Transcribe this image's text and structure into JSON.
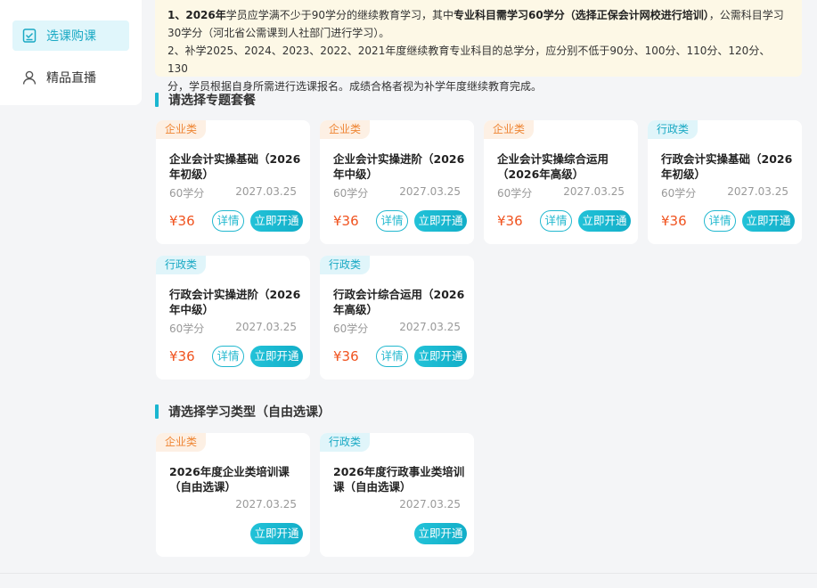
{
  "sidebar": {
    "items": [
      {
        "label": "选课购课",
        "icon": "checkbox-list-icon",
        "active": true
      },
      {
        "label": "精品直播",
        "icon": "user-icon",
        "active": false
      }
    ]
  },
  "notice": {
    "l1_a": "1、2026年",
    "l1_b": "学员应学满不少于90学分的继续教育学习，其中",
    "l1_c": "专业科目需学习60学分（选择正保会计网校进行培训）",
    "l1_d": "，公需科目学习",
    "l2": "30学分（河北省公需课到人社部门进行学习）。",
    "l3": "2、补学2025、2024、2023、2022、2021年度继续教育专业科目的总学分，应分别不低于90分、100分、110分、120分、130",
    "l4": "分，学员根据自身所需进行选课报名。成绩合格者视为补学年度继续教育完成。"
  },
  "section1": {
    "title": "请选择专题套餐",
    "cards": [
      {
        "tag": "企业类",
        "tag_type": "ent",
        "title": "企业会计实操基础（2026年初级）",
        "credits": "60学分",
        "date": "2027.03.25",
        "price": "¥36",
        "detail": "详情",
        "open": "立即开通"
      },
      {
        "tag": "企业类",
        "tag_type": "ent",
        "title": "企业会计实操进阶（2026年中级）",
        "credits": "60学分",
        "date": "2027.03.25",
        "price": "¥36",
        "detail": "详情",
        "open": "立即开通"
      },
      {
        "tag": "企业类",
        "tag_type": "ent",
        "title": "企业会计实操综合运用（2026年高级）",
        "credits": "60学分",
        "date": "2027.03.25",
        "price": "¥36",
        "detail": "详情",
        "open": "立即开通"
      },
      {
        "tag": "行政类",
        "tag_type": "adm",
        "title": "行政会计实操基础（2026年初级）",
        "credits": "60学分",
        "date": "2027.03.25",
        "price": "¥36",
        "detail": "详情",
        "open": "立即开通"
      },
      {
        "tag": "行政类",
        "tag_type": "adm",
        "title": "行政会计实操进阶（2026年中级）",
        "credits": "60学分",
        "date": "2027.03.25",
        "price": "¥36",
        "detail": "详情",
        "open": "立即开通"
      },
      {
        "tag": "行政类",
        "tag_type": "adm",
        "title": "行政会计综合运用（2026年高级）",
        "credits": "60学分",
        "date": "2027.03.25",
        "price": "¥36",
        "detail": "详情",
        "open": "立即开通"
      }
    ]
  },
  "section2": {
    "title": "请选择学习类型（自由选课）",
    "cards": [
      {
        "tag": "企业类",
        "tag_type": "ent",
        "title": "2026年度企业类培训课（自由选课）",
        "date": "2027.03.25",
        "open": "立即开通"
      },
      {
        "tag": "行政类",
        "tag_type": "adm",
        "title": "2026年度行政事业类培训课（自由选课）",
        "date": "2027.03.25",
        "open": "立即开通"
      }
    ]
  },
  "colors": {
    "accent": "#1ab6d0",
    "price": "#f0531f",
    "ent_tag": "#ee8533",
    "notice_bg": "#fdf8e6"
  }
}
